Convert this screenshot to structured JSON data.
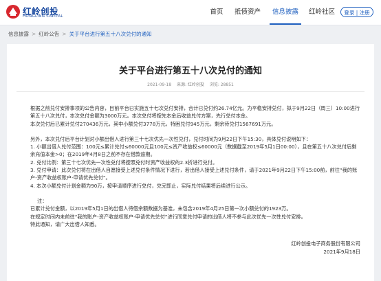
{
  "header": {
    "logo_cn": "红岭创投",
    "logo_en": "HONGLING CAPITAL",
    "nav": [
      {
        "label": "首页",
        "active": false
      },
      {
        "label": "抵债资产",
        "active": false
      },
      {
        "label": "信息披露",
        "active": true
      },
      {
        "label": "红岭社区",
        "active": false
      }
    ],
    "login_label": "登录",
    "auth_separator": "|",
    "register_label": "注册"
  },
  "breadcrumb": {
    "items": [
      "信息披露",
      "红岭公告",
      "关于平台进行第五十八次兑付的通知"
    ],
    "separator": ">"
  },
  "article": {
    "title": "关于平台进行第五十八次兑付的通知",
    "date": "2021-09-18",
    "source": "来源: 红岭创投",
    "views": "浏览: 28851",
    "paragraphs": [
      "根据之前兑付安排事项的公告内容，目前平台已实施五十七次兑付安排，合计已兑付约26.74亿元。为平稳安排兑付，拟于9月22日（周三）10:00进行第五十八次兑付，本次兑付金额为3000万元。本次兑付将按先本金后收益兑付方案，先行兑付本金。",
      "本次兑付后已累计兑付270436万元，其中小额兑付3778万元，特困兑付945万元，剩余待兑付1567691万元。",
      "",
      "另外，本次兑付后平台计划对小额出借人进行第三十七次优先一次性兑付，兑付时间为9月22日下午15:30，具体兑付说明如下：",
      "1. 小额出借人兑付范围：100元≤累计兑付≤60000元且100元≤资产收益权≤60000元（数据截至2019年5月1日00:00），且在第五十八次兑付后剩余充值本金>0；在2019年4月8日之前不存在借款逾期。",
      "2. 兑付比例：第三十七次优先一次性兑付将按照兑付时资产收益权的2.3折进行兑付。",
      "3. 兑付申请：此次兑付将在出借人自愿接受上述兑付条件情况下进行，若出借人接受上述兑付条件，请于2021年9月22日下午15:00前，前往“我的账户-资产收益权账户-申请优先兑付”。",
      "4. 本次小额兑付计划金额为90万，按申请顺序进行兑付，兑完即止，实际兑付结果将后续进行公示。",
      "",
      "注：",
      "已累计兑付金额，以2019年5月1日的出借人待借余额数据为基准，未包含2019年4月25日第一次小额兑付的1923万。",
      "在规定时间内未前往“我的账户-资产收益权账户-申请优先兑付”进行同意兑付申请的出借人将不参与此次优先一次性兑付安排。",
      "特此通知，请广大出借人知悉。"
    ],
    "signature_company": "红岭创投电子商务股份有限公司",
    "signature_date": "2021年9月18日"
  }
}
